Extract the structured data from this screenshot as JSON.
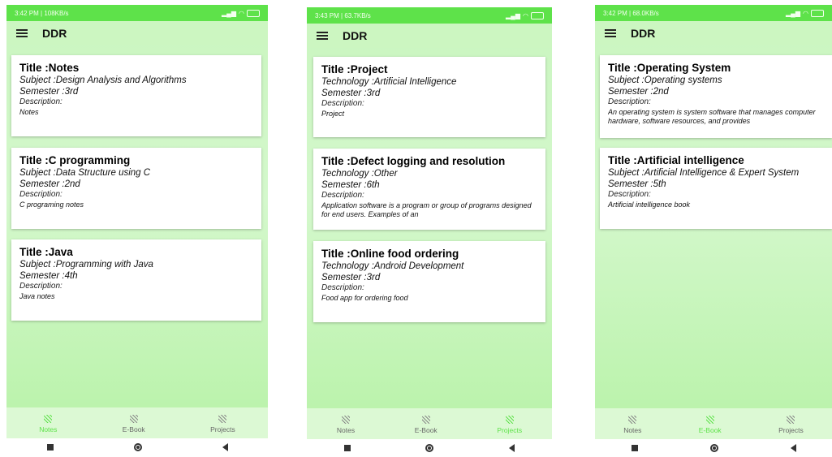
{
  "screens": [
    {
      "status": {
        "time": "3:42 PM | 108KB/s",
        "icons": "P P"
      },
      "app_title": "DDR",
      "cards": [
        {
          "title": "Title :Notes",
          "line1": "Subject :Design Analysis and Algorithms",
          "line2": "Semester :3rd",
          "desc_label": "Description:",
          "desc": "Notes"
        },
        {
          "title": "Title :C programming",
          "line1": "Subject :Data Structure using C",
          "line2": "Semester :2nd",
          "desc_label": "Description:",
          "desc": "C programing notes"
        },
        {
          "title": "Title :Java",
          "line1": "Subject :Programming with Java",
          "line2": "Semester :4th",
          "desc_label": "Description:",
          "desc": "Java notes"
        }
      ],
      "nav": [
        "Notes",
        "E-Book",
        "Projects"
      ],
      "active": 0
    },
    {
      "status": {
        "time": "3:43 PM | 63.7KB/s",
        "icons": "P P"
      },
      "app_title": "DDR",
      "cards": [
        {
          "title": "Title :Project",
          "line1": "Technology :Artificial Intelligence",
          "line2": "Semester :3rd",
          "desc_label": "Description:",
          "desc": "Project"
        },
        {
          "title": "Title :Defect logging and resolution",
          "line1": "Technology :Other",
          "line2": "Semester :6th",
          "desc_label": "Description:",
          "desc": "Application software is a program or group of programs designed for end users. Examples of an"
        },
        {
          "title": "Title :Online food ordering",
          "line1": "Technology :Android Development",
          "line2": "Semester :3rd",
          "desc_label": "Description:",
          "desc": "Food app for ordering food"
        }
      ],
      "nav": [
        "Notes",
        "E-Book",
        "Projects"
      ],
      "active": 2
    },
    {
      "status": {
        "time": "3:42 PM | 68.0KB/s",
        "icons": "P P"
      },
      "app_title": "DDR",
      "cards": [
        {
          "title": "Title :Operating System",
          "line1": "Subject :Operating systems",
          "line2": "Semester :2nd",
          "desc_label": "Description:",
          "desc": "An operating system is system software that manages computer hardware, software resources, and provides"
        },
        {
          "title": "Title :Artificial intelligence",
          "line1": "Subject :Artificial Intelligence & Expert System",
          "line2": "Semester :5th",
          "desc_label": "Description:",
          "desc": "Artificial intelligence book"
        }
      ],
      "nav": [
        "Notes",
        "E-Book",
        "Projects"
      ],
      "active": 1
    }
  ]
}
